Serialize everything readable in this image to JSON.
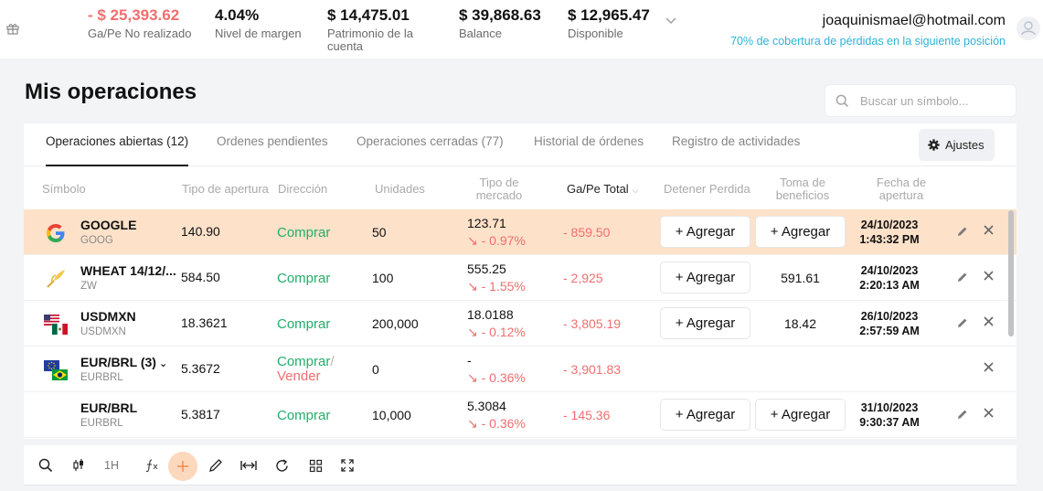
{
  "header": {
    "metrics": [
      {
        "value": "- $ 25,393.62",
        "label": "Ga/Pe No realizado",
        "negative": true
      },
      {
        "value": "4.04%",
        "label": "Nivel de margen",
        "negative": false
      },
      {
        "value": "$ 14,475.01",
        "label": "Patrimonio de la cuenta",
        "negative": false
      },
      {
        "value": "$ 39,868.63",
        "label": "Balance",
        "negative": false
      },
      {
        "value": "$ 12,965.47",
        "label": "Disponible",
        "negative": false
      }
    ],
    "email": "joaquinismael@hotmail.com",
    "coverage": "70% de cobertura de pérdidas en la siguiente posición"
  },
  "page": {
    "title": "Mis operaciones",
    "search_placeholder": "Buscar un símbolo..."
  },
  "tabs": [
    {
      "label": "Operaciones abiertas (12)",
      "active": true
    },
    {
      "label": "Ordenes pendientes",
      "active": false
    },
    {
      "label": "Operaciones cerradas (77)",
      "active": false
    },
    {
      "label": "Historial de órdenes",
      "active": false
    },
    {
      "label": "Registro de actividades",
      "active": false
    }
  ],
  "settings_label": "Ajustes",
  "columns": {
    "symbol": "Símbolo",
    "open_price": "Tipo de apertura",
    "direction": "Dirección",
    "units": "Unidades",
    "market": "Tipo de mercado",
    "pl_total": "Ga/Pe Total",
    "stop_loss": "Detener Perdida",
    "take_profit": "Toma de beneficios",
    "open_date": "Fecha de apertura"
  },
  "add_label": "+ Agregar",
  "rows": [
    {
      "name": "GOOGLE",
      "code": "GOOG",
      "icon": "google-logo-icon",
      "open": "140.90",
      "direction": "Comprar",
      "units": "50",
      "market": "123.71",
      "change": "↘ - 0.97%",
      "pl": "- 859.50",
      "take_profit": "",
      "date": "24/10/2023",
      "time": "1:43:32 PM"
    },
    {
      "name": "WHEAT 14/12/...",
      "code": "ZW",
      "icon": "wheat-icon",
      "open": "584.50",
      "direction": "Comprar",
      "units": "100",
      "market": "555.25",
      "change": "↘ - 1.55%",
      "pl": "- 2,925",
      "take_profit": "591.61",
      "date": "24/10/2023",
      "time": "2:20:13 AM"
    },
    {
      "name": "USDMXN",
      "code": "USDMXN",
      "icon": "us-mx-flags-icon",
      "open": "18.3621",
      "direction": "Comprar",
      "units": "200,000",
      "market": "18.0188",
      "change": "↘ - 0.12%",
      "pl": "- 3,805.19",
      "take_profit": "18.42",
      "date": "26/10/2023",
      "time": "2:57:59 AM"
    },
    {
      "name": "EUR/BRL (3)",
      "code": "EURBRL",
      "icon": "eu-br-flags-icon",
      "open": "5.3672",
      "direction": "Comprar",
      "direction2": "Vender",
      "units": "0",
      "market": "-",
      "change": "↘ - 0.36%",
      "pl": "- 3,901.83",
      "take_profit": "",
      "date": "",
      "time": ""
    },
    {
      "name": "EUR/BRL",
      "code": "EURBRL",
      "icon": "",
      "open": "5.3817",
      "direction": "Comprar",
      "units": "10,000",
      "market": "5.3084",
      "change": "↘ - 0.36%",
      "pl": "- 145.36",
      "take_profit": "",
      "date": "31/10/2023",
      "time": "9:30:37 AM"
    }
  ],
  "toolbar": {
    "interval": "1H"
  }
}
